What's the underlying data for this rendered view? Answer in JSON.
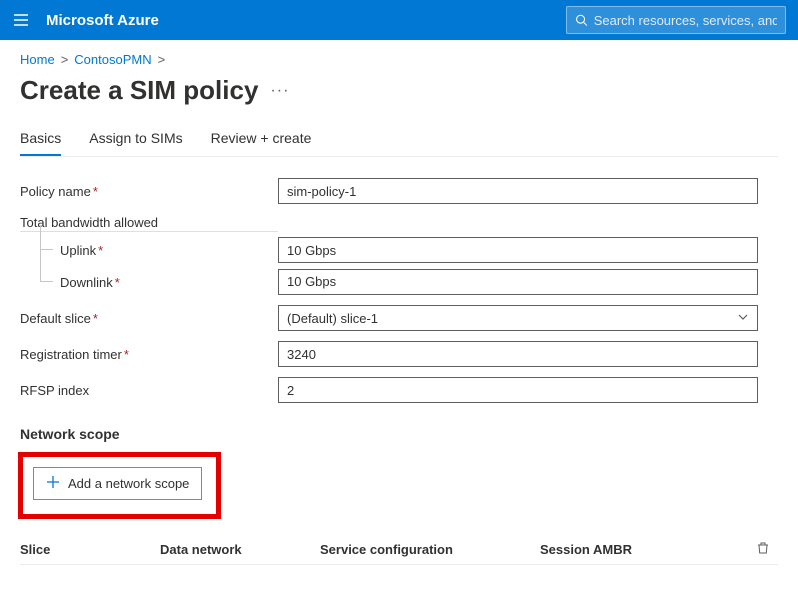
{
  "header": {
    "brand": "Microsoft Azure",
    "search_placeholder": "Search resources, services, and docs"
  },
  "breadcrumb": {
    "home": "Home",
    "resource": "ContosoPMN"
  },
  "page": {
    "title": "Create a SIM policy"
  },
  "tabs": [
    {
      "label": "Basics",
      "active": true
    },
    {
      "label": "Assign to SIMs",
      "active": false
    },
    {
      "label": "Review + create",
      "active": false
    }
  ],
  "form": {
    "policy_name_label": "Policy name",
    "policy_name": "sim-policy-1",
    "bandwidth_group": "Total bandwidth allowed",
    "uplink_label": "Uplink",
    "uplink": "10 Gbps",
    "downlink_label": "Downlink",
    "downlink": "10 Gbps",
    "default_slice_label": "Default slice",
    "default_slice": "(Default) slice-1",
    "reg_timer_label": "Registration timer",
    "reg_timer": "3240",
    "rfsp_label": "RFSP index",
    "rfsp": "2"
  },
  "network_scope": {
    "heading": "Network scope",
    "add_button": "Add a network scope",
    "columns": {
      "slice": "Slice",
      "data_network": "Data network",
      "service_config": "Service configuration",
      "session_ambr": "Session AMBR"
    }
  }
}
